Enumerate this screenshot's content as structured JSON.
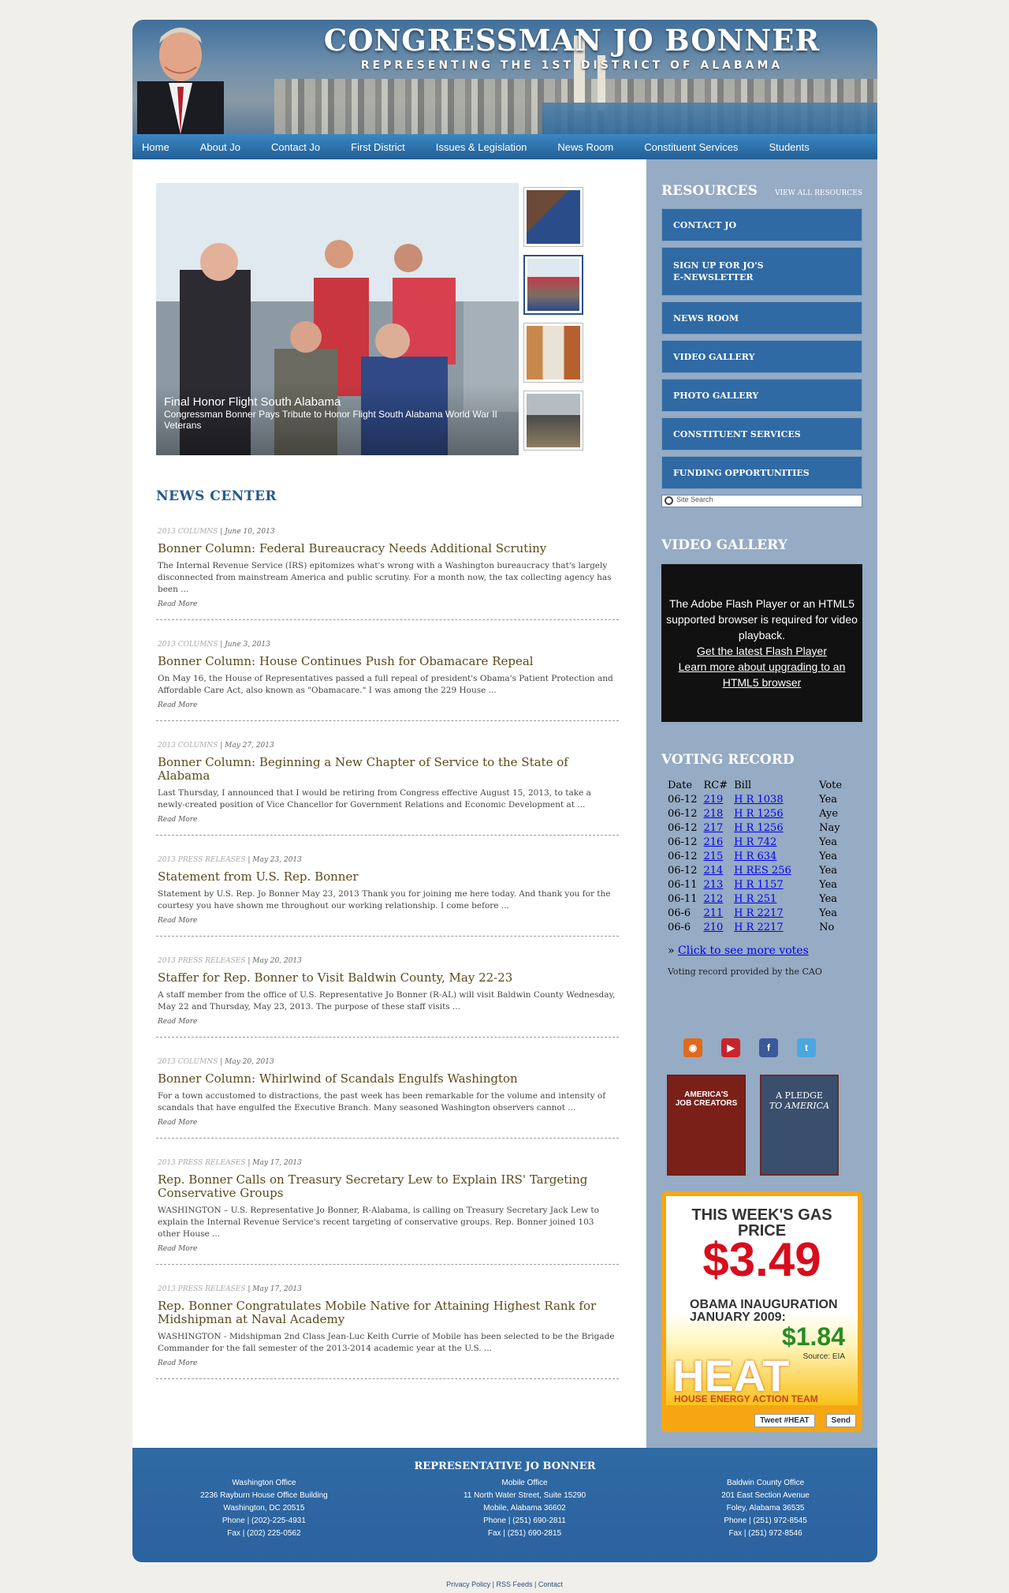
{
  "header": {
    "title": "CONGRESSMAN JO BONNER",
    "subtitle": "REPRESENTING THE 1ST DISTRICT OF ALABAMA"
  },
  "nav": [
    "Home",
    "About Jo",
    "Contact Jo",
    "First District",
    "Issues & Legislation",
    "News Room",
    "Constituent Services",
    "Students"
  ],
  "slider": {
    "caption_title": "Final Honor Flight South Alabama",
    "caption_text": "Congressman Bonner Pays Tribute to Honor Flight South Alabama World War II Veterans"
  },
  "news_center": {
    "heading": "NEWS CENTER",
    "read_more": "Read More",
    "items": [
      {
        "category": "2013 COLUMNS",
        "date": "June 10, 2013",
        "title": "Bonner Column: Federal Bureaucracy Needs Additional Scrutiny",
        "excerpt": "The Internal Revenue Service (IRS) epitomizes what's wrong with a Washington bureaucracy that's largely disconnected from mainstream America and public scrutiny. For a month now, the tax collecting agency has been ..."
      },
      {
        "category": "2013 COLUMNS",
        "date": "June 3, 2013",
        "title": "Bonner Column: House Continues Push for Obamacare Repeal",
        "excerpt": "On May 16, the House of Representatives passed a full repeal of president's Obama's Patient Protection and Affordable Care Act, also known as \"Obamacare.\" I was among the 229 House ..."
      },
      {
        "category": "2013 COLUMNS",
        "date": "May 27, 2013",
        "title": "Bonner Column: Beginning a New Chapter of Service to the State of Alabama",
        "excerpt": "Last Thursday, I announced that I would be retiring from Congress effective August 15, 2013, to take a newly-created position of Vice Chancellor for Government Relations and Economic Development at ..."
      },
      {
        "category": "2013 PRESS RELEASES",
        "date": "May 23, 2013",
        "title": "Statement from U.S. Rep. Bonner",
        "excerpt": "Statement by U.S. Rep. Jo Bonner May 23, 2013 Thank you for joining me here today. And thank you for the courtesy you have shown me throughout our working relationship. I come before ..."
      },
      {
        "category": "2013 PRESS RELEASES",
        "date": "May 20, 2013",
        "title": "Staffer for Rep. Bonner to Visit Baldwin County, May 22-23",
        "excerpt": "A staff member from the office of U.S. Representative Jo Bonner (R-AL) will visit Baldwin County Wednesday, May 22 and Thursday, May 23, 2013.  The purpose of these staff visits ..."
      },
      {
        "category": "2013 COLUMNS",
        "date": "May 20, 2013",
        "title": "Bonner Column: Whirlwind of Scandals Engulfs Washington",
        "excerpt": "For a town accustomed to distractions, the past week has been remarkable for the volume and intensity of scandals that have engulfed the Executive Branch.  Many seasoned Washington observers cannot ..."
      },
      {
        "category": "2013 PRESS RELEASES",
        "date": "May 17, 2013",
        "title": "Rep. Bonner Calls on Treasury Secretary Lew to Explain IRS' Targeting Conservative Groups",
        "excerpt": "WASHINGTON – U.S. Representative Jo Bonner, R-Alabama, is calling on Treasury Secretary Jack Lew to explain the Internal Revenue Service's recent targeting of conservative groups. Rep. Bonner joined 103 other House ..."
      },
      {
        "category": "2013 PRESS RELEASES",
        "date": "May 17, 2013",
        "title": "Rep. Bonner Congratulates Mobile Native for Attaining Highest Rank for Midshipman at Naval Academy",
        "excerpt": "WASHINGTON - Midshipman 2nd Class Jean-Luc Keith Currie of Mobile has been selected to be the Brigade Commander for the fall semester of the 2013-2014 academic year at the U.S. ..."
      }
    ]
  },
  "resources": {
    "heading": "RESOURCES",
    "view_all": "VIEW ALL RESOURCES",
    "items": [
      "CONTACT JO",
      "SIGN UP FOR JO'S E-NEWSLETTER",
      "NEWS ROOM",
      "VIDEO GALLERY",
      "PHOTO GALLERY",
      "CONSTITUENT SERVICES",
      "FUNDING OPPORTUNITIES"
    ],
    "search_placeholder": "Site Search"
  },
  "video": {
    "heading": "VIDEO GALLERY",
    "message": "The Adobe Flash Player or an HTML5 supported browser is required for video playback.",
    "link1": "Get the latest Flash Player",
    "link2": "Learn more about upgrading to an HTML5 browser"
  },
  "voting": {
    "heading": "VOTING RECORD",
    "columns": [
      "Date",
      "RC#",
      "Bill",
      "Vote"
    ],
    "rows": [
      [
        "06-12",
        "219",
        "H R 1038",
        "Yea"
      ],
      [
        "06-12",
        "218",
        "H R 1256",
        "Aye"
      ],
      [
        "06-12",
        "217",
        "H R 1256",
        "Nay"
      ],
      [
        "06-12",
        "216",
        "H R 742",
        "Yea"
      ],
      [
        "06-12",
        "215",
        "H R 634",
        "Yea"
      ],
      [
        "06-12",
        "214",
        "H RES 256",
        "Yea"
      ],
      [
        "06-11",
        "213",
        "H R 1157",
        "Yea"
      ],
      [
        "06-11",
        "212",
        "H R 251",
        "Yea"
      ],
      [
        "06-6",
        "211",
        "H R 2217",
        "Yea"
      ],
      [
        "06-6",
        "210",
        "H R 2217",
        "No"
      ]
    ],
    "more_prefix": "»",
    "more_link": "Click to see more votes",
    "provided": "Voting record provided by the CAO"
  },
  "books": [
    {
      "line1": "AMERICA'S",
      "line2": "JOB CREATORS"
    },
    {
      "line1": "A PLEDGE",
      "line2": "TO AMERICA"
    }
  ],
  "gas": {
    "line1": "THIS WEEK'S GAS PRICE",
    "price": "$3.49",
    "line2": "OBAMA INAUGURATION JANUARY 2009:",
    "price2": "$1.84",
    "source": "Source: EIA",
    "heat": "HEAT",
    "heat_full": "HOUSE ENERGY ACTION TEAM",
    "tweet": "Tweet #HEAT",
    "send": "Send"
  },
  "footer": {
    "heading": "REPRESENTATIVE JO BONNER",
    "offices": [
      {
        "name": "Washington Office",
        "addr1": "2236 Rayburn House Office Building",
        "addr2": "Washington, DC 20515",
        "phone": "Phone | (202)-225-4931",
        "fax": "Fax | (202) 225-0562"
      },
      {
        "name": "Mobile Office",
        "addr1": "11 North Water Street, Suite 15290",
        "addr2": "Mobile, Alabama 36602",
        "phone": "Phone | (251) 690-2811",
        "fax": "Fax | (251) 690-2815"
      },
      {
        "name": "Baldwin County Office",
        "addr1": "201 East Section Avenue",
        "addr2": "Foley, Alabama 36535",
        "phone": "Phone | (251) 972-8545",
        "fax": "Fax | (251) 972-8546"
      }
    ],
    "links": [
      "Privacy Policy",
      "RSS Feeds",
      "Contact"
    ]
  },
  "colors": {
    "nav_blue": "#2f6aa4",
    "sidebar": "#96abc4",
    "heading_blue": "#245a90",
    "price_red": "#d80c1c",
    "price_green": "#2a8a26"
  }
}
